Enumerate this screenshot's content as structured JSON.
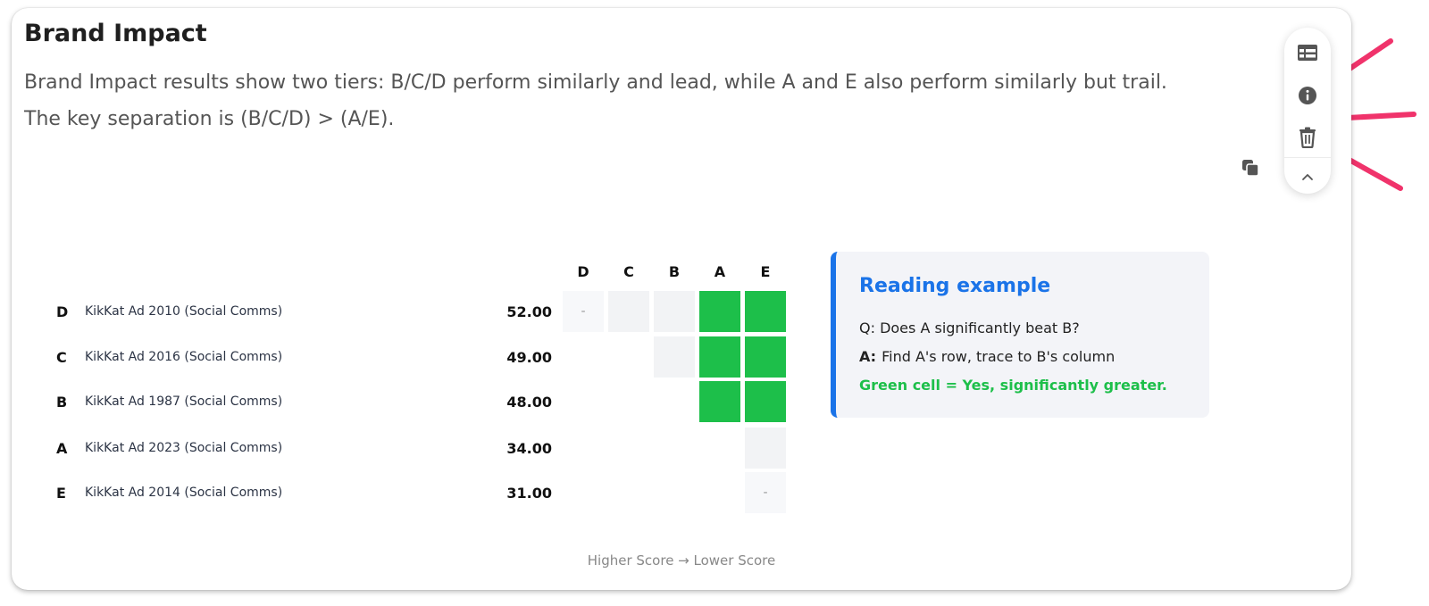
{
  "panel": {
    "title": "Brand Impact",
    "description": "Brand Impact results show two tiers: B/C/D perform similarly and lead, while A and E also perform similarly but trail. The key separation is (B/C/D) > (A/E)."
  },
  "toolbar": {
    "icons": [
      "table-icon",
      "info-icon",
      "trash-icon",
      "chevron-up-icon"
    ],
    "copy_icon": "copy-icon",
    "highlight_color": "#f0336b"
  },
  "matrix": {
    "columns": [
      "D",
      "C",
      "B",
      "A",
      "E"
    ],
    "rows": [
      {
        "code": "D",
        "name": "KikKat Ad 2010 (Social Comms)",
        "score": "52.00"
      },
      {
        "code": "C",
        "name": "KikKat Ad 2016 (Social Comms)",
        "score": "49.00"
      },
      {
        "code": "B",
        "name": "KikKat Ad 1987 (Social Comms)",
        "score": "48.00"
      },
      {
        "code": "A",
        "name": "KikKat Ad 2023 (Social Comms)",
        "score": "34.00"
      },
      {
        "code": "E",
        "name": "KikKat Ad 2014 (Social Comms)",
        "score": "31.00"
      }
    ],
    "cells": [
      [
        "-",
        "neutral",
        "neutral",
        "sig",
        "sig"
      ],
      [
        null,
        null,
        "neutral",
        "sig",
        "sig"
      ],
      [
        null,
        null,
        null,
        "sig",
        "sig"
      ],
      [
        null,
        null,
        null,
        null,
        "neutral"
      ],
      [
        null,
        null,
        null,
        null,
        "-"
      ]
    ],
    "diagonal_symbol": "-",
    "significant_color": "#1dbf4a",
    "axis_caption": "Higher Score → Lower Score"
  },
  "reading_example": {
    "title": "Reading example",
    "question": "Q: Does A significantly beat B?",
    "answer_label": "A:",
    "answer_text": "Find A's row, trace to B's column",
    "green_note": "Green cell = Yes, significantly greater.",
    "accent_color": "#1a73e8"
  }
}
